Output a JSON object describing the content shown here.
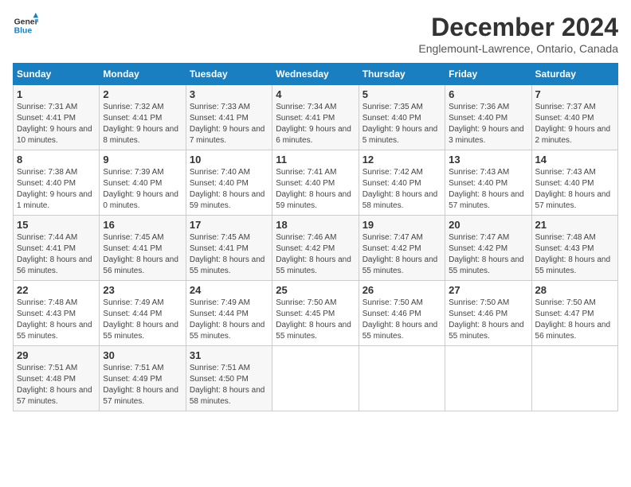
{
  "header": {
    "logo_line1": "General",
    "logo_line2": "Blue",
    "month": "December 2024",
    "location": "Englemount-Lawrence, Ontario, Canada"
  },
  "weekdays": [
    "Sunday",
    "Monday",
    "Tuesday",
    "Wednesday",
    "Thursday",
    "Friday",
    "Saturday"
  ],
  "weeks": [
    [
      {
        "day": "1",
        "sunrise": "7:31 AM",
        "sunset": "4:41 PM",
        "daylight": "9 hours and 10 minutes."
      },
      {
        "day": "2",
        "sunrise": "7:32 AM",
        "sunset": "4:41 PM",
        "daylight": "9 hours and 8 minutes."
      },
      {
        "day": "3",
        "sunrise": "7:33 AM",
        "sunset": "4:41 PM",
        "daylight": "9 hours and 7 minutes."
      },
      {
        "day": "4",
        "sunrise": "7:34 AM",
        "sunset": "4:41 PM",
        "daylight": "9 hours and 6 minutes."
      },
      {
        "day": "5",
        "sunrise": "7:35 AM",
        "sunset": "4:40 PM",
        "daylight": "9 hours and 5 minutes."
      },
      {
        "day": "6",
        "sunrise": "7:36 AM",
        "sunset": "4:40 PM",
        "daylight": "9 hours and 3 minutes."
      },
      {
        "day": "7",
        "sunrise": "7:37 AM",
        "sunset": "4:40 PM",
        "daylight": "9 hours and 2 minutes."
      }
    ],
    [
      {
        "day": "8",
        "sunrise": "7:38 AM",
        "sunset": "4:40 PM",
        "daylight": "9 hours and 1 minute."
      },
      {
        "day": "9",
        "sunrise": "7:39 AM",
        "sunset": "4:40 PM",
        "daylight": "9 hours and 0 minutes."
      },
      {
        "day": "10",
        "sunrise": "7:40 AM",
        "sunset": "4:40 PM",
        "daylight": "8 hours and 59 minutes."
      },
      {
        "day": "11",
        "sunrise": "7:41 AM",
        "sunset": "4:40 PM",
        "daylight": "8 hours and 59 minutes."
      },
      {
        "day": "12",
        "sunrise": "7:42 AM",
        "sunset": "4:40 PM",
        "daylight": "8 hours and 58 minutes."
      },
      {
        "day": "13",
        "sunrise": "7:43 AM",
        "sunset": "4:40 PM",
        "daylight": "8 hours and 57 minutes."
      },
      {
        "day": "14",
        "sunrise": "7:43 AM",
        "sunset": "4:40 PM",
        "daylight": "8 hours and 57 minutes."
      }
    ],
    [
      {
        "day": "15",
        "sunrise": "7:44 AM",
        "sunset": "4:41 PM",
        "daylight": "8 hours and 56 minutes."
      },
      {
        "day": "16",
        "sunrise": "7:45 AM",
        "sunset": "4:41 PM",
        "daylight": "8 hours and 56 minutes."
      },
      {
        "day": "17",
        "sunrise": "7:45 AM",
        "sunset": "4:41 PM",
        "daylight": "8 hours and 55 minutes."
      },
      {
        "day": "18",
        "sunrise": "7:46 AM",
        "sunset": "4:42 PM",
        "daylight": "8 hours and 55 minutes."
      },
      {
        "day": "19",
        "sunrise": "7:47 AM",
        "sunset": "4:42 PM",
        "daylight": "8 hours and 55 minutes."
      },
      {
        "day": "20",
        "sunrise": "7:47 AM",
        "sunset": "4:42 PM",
        "daylight": "8 hours and 55 minutes."
      },
      {
        "day": "21",
        "sunrise": "7:48 AM",
        "sunset": "4:43 PM",
        "daylight": "8 hours and 55 minutes."
      }
    ],
    [
      {
        "day": "22",
        "sunrise": "7:48 AM",
        "sunset": "4:43 PM",
        "daylight": "8 hours and 55 minutes."
      },
      {
        "day": "23",
        "sunrise": "7:49 AM",
        "sunset": "4:44 PM",
        "daylight": "8 hours and 55 minutes."
      },
      {
        "day": "24",
        "sunrise": "7:49 AM",
        "sunset": "4:44 PM",
        "daylight": "8 hours and 55 minutes."
      },
      {
        "day": "25",
        "sunrise": "7:50 AM",
        "sunset": "4:45 PM",
        "daylight": "8 hours and 55 minutes."
      },
      {
        "day": "26",
        "sunrise": "7:50 AM",
        "sunset": "4:46 PM",
        "daylight": "8 hours and 55 minutes."
      },
      {
        "day": "27",
        "sunrise": "7:50 AM",
        "sunset": "4:46 PM",
        "daylight": "8 hours and 55 minutes."
      },
      {
        "day": "28",
        "sunrise": "7:50 AM",
        "sunset": "4:47 PM",
        "daylight": "8 hours and 56 minutes."
      }
    ],
    [
      {
        "day": "29",
        "sunrise": "7:51 AM",
        "sunset": "4:48 PM",
        "daylight": "8 hours and 57 minutes."
      },
      {
        "day": "30",
        "sunrise": "7:51 AM",
        "sunset": "4:49 PM",
        "daylight": "8 hours and 57 minutes."
      },
      {
        "day": "31",
        "sunrise": "7:51 AM",
        "sunset": "4:50 PM",
        "daylight": "8 hours and 58 minutes."
      },
      null,
      null,
      null,
      null
    ]
  ]
}
